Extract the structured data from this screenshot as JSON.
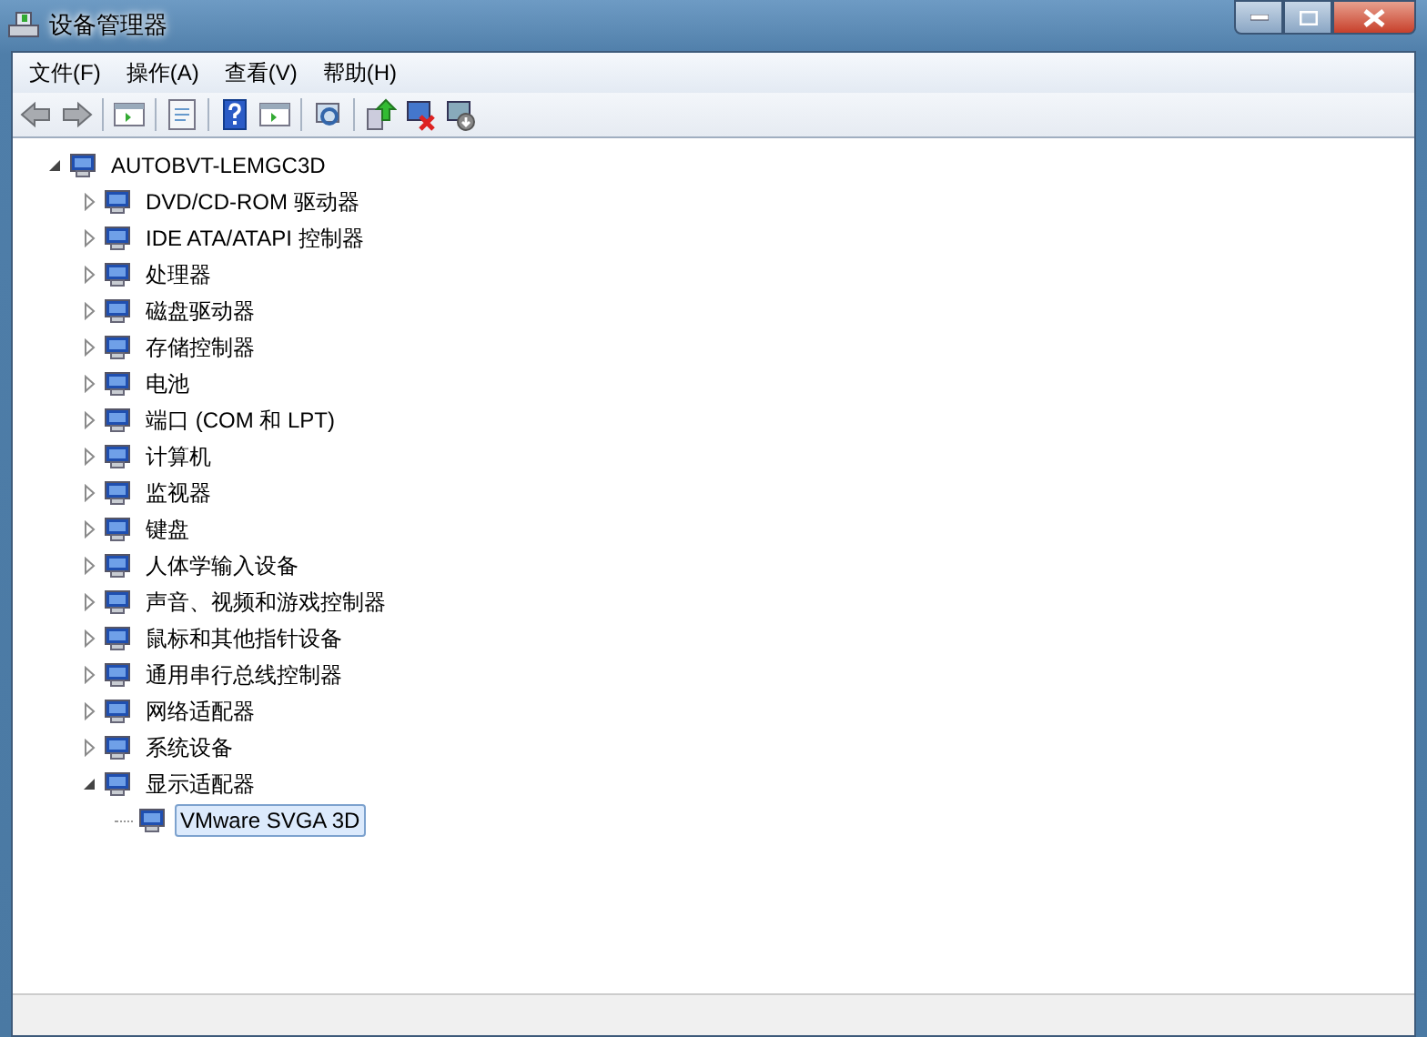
{
  "window": {
    "title": "设备管理器"
  },
  "menu": [
    "文件(F)",
    "操作(A)",
    "查看(V)",
    "帮助(H)"
  ],
  "tree": {
    "label": "AUTOBVT-LEMGC3D",
    "expanded": true,
    "selected": false,
    "children": [
      {
        "label": "DVD/CD-ROM 驱动器",
        "expanded": false,
        "selected": false
      },
      {
        "label": "IDE ATA/ATAPI 控制器",
        "expanded": false,
        "selected": false
      },
      {
        "label": "处理器",
        "expanded": false,
        "selected": false
      },
      {
        "label": "磁盘驱动器",
        "expanded": false,
        "selected": false
      },
      {
        "label": "存储控制器",
        "expanded": false,
        "selected": false
      },
      {
        "label": "电池",
        "expanded": false,
        "selected": false
      },
      {
        "label": "端口 (COM 和 LPT)",
        "expanded": false,
        "selected": false
      },
      {
        "label": "计算机",
        "expanded": false,
        "selected": false
      },
      {
        "label": "监视器",
        "expanded": false,
        "selected": false
      },
      {
        "label": "键盘",
        "expanded": false,
        "selected": false
      },
      {
        "label": "人体学输入设备",
        "expanded": false,
        "selected": false
      },
      {
        "label": "声音、视频和游戏控制器",
        "expanded": false,
        "selected": false
      },
      {
        "label": "鼠标和其他指针设备",
        "expanded": false,
        "selected": false
      },
      {
        "label": "通用串行总线控制器",
        "expanded": false,
        "selected": false
      },
      {
        "label": "网络适配器",
        "expanded": false,
        "selected": false
      },
      {
        "label": "系统设备",
        "expanded": false,
        "selected": false
      },
      {
        "label": "显示适配器",
        "expanded": true,
        "selected": false,
        "children": [
          {
            "label": "VMware SVGA 3D",
            "selected": true
          }
        ]
      }
    ]
  }
}
